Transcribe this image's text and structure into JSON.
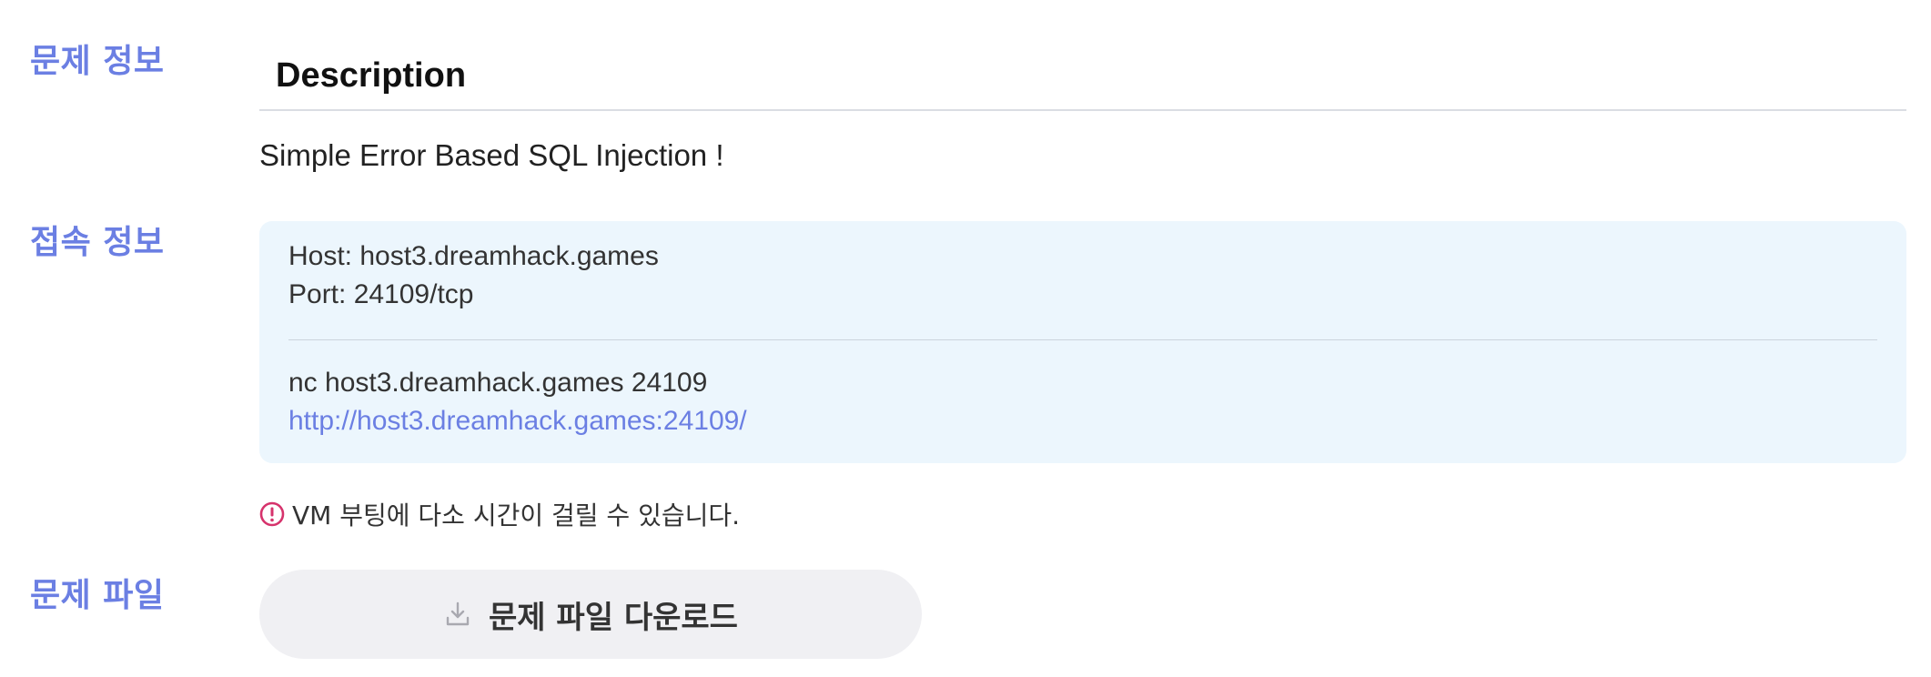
{
  "sections": {
    "info_label": "문제 정보",
    "connection_label": "접속 정보",
    "files_label": "문제 파일"
  },
  "description": {
    "title": "Description",
    "text": "Simple Error Based SQL Injection !"
  },
  "connection": {
    "host": "Host: host3.dreamhack.games",
    "port": "Port: 24109/tcp",
    "nc_command": "nc host3.dreamhack.games 24109",
    "url": "http://host3.dreamhack.games:24109/"
  },
  "notice": {
    "icon": "exclamation-circle-icon",
    "text": "VM 부팅에 다소 시간이 걸릴 수 있습니다."
  },
  "download": {
    "icon": "download-icon",
    "label": "문제 파일 다운로드"
  },
  "colors": {
    "accent": "#6b7fe3",
    "connection_bg": "#ecf6fd",
    "notice_icon": "#d6336c",
    "button_bg": "#f0f0f3"
  }
}
